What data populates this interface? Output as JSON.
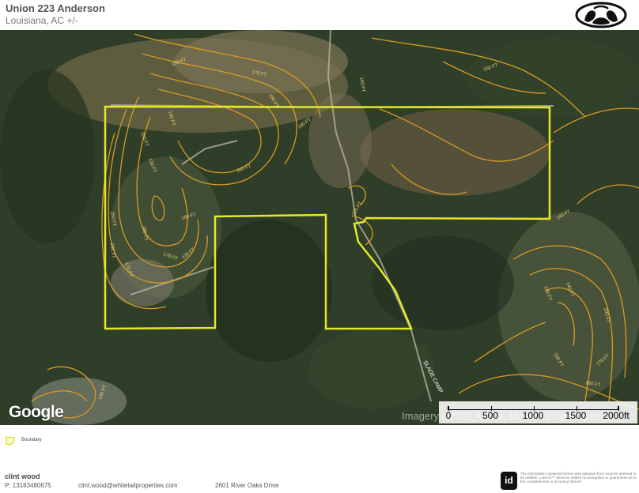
{
  "header": {
    "title": "Union 223 Anderson",
    "subtitle": "Louisiana, AC +/-",
    "logo_icon": "whitetail-track-logo"
  },
  "map": {
    "basemap": "satellite-imagery",
    "google_logo": "Google",
    "imagery_credit": "Imagery ©2023 Airbus, Maxar Technologies",
    "road_label": "SLADE CAMP",
    "contour_labels": [
      "150 FT",
      "170 FT",
      "190 FT",
      "180 FT",
      "160 FT",
      "140 FT",
      "130 FT",
      "200 FT",
      "250 FT",
      "230 FT",
      "170 FT",
      "150 FT",
      "150 FT",
      "140 FT",
      "130 FT",
      "120 FT",
      "160 FT",
      "170 FT",
      "180 FT",
      "140 FT",
      "200 FT",
      "170 FT",
      "160 FT",
      "150 FT",
      "130 FT",
      "140 FT"
    ],
    "scale": {
      "labels": [
        "0",
        "500",
        "1000",
        "1500",
        "2000ft"
      ]
    },
    "colors": {
      "boundary": "#e4e829",
      "contour": "#d99a22",
      "contour_label": "#f0d27a"
    }
  },
  "legend": {
    "items": [
      {
        "label": "Boundary",
        "icon": "boundary-polygon-icon"
      }
    ]
  },
  "contact": {
    "name": "clint wood",
    "phone": "P: 13183480675",
    "email": "clint.wood@whitetailproperties.com",
    "address": "2601 River Oaks Drive"
  },
  "footer": {
    "id_logo": "id",
    "disclaimer": "The information contained herein was obtained from sources deemed to be reliable. Land id™ Services makes no warranties or guarantees as to the completeness or accuracy thereof."
  }
}
